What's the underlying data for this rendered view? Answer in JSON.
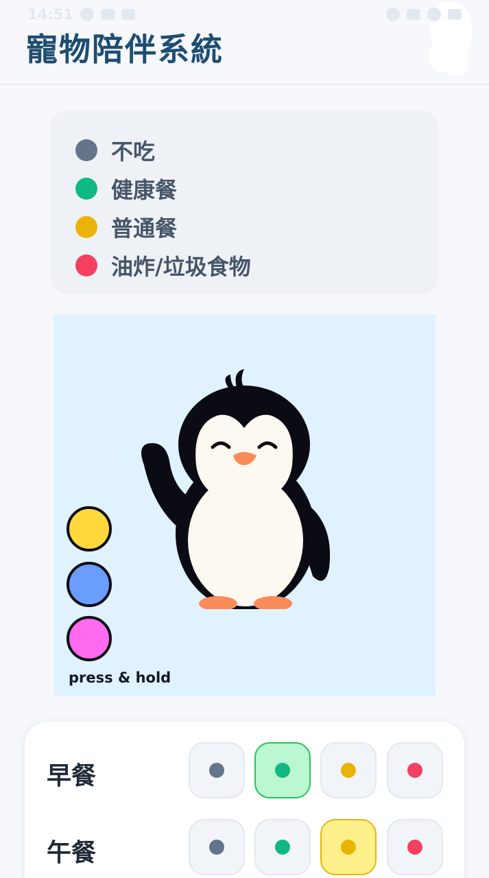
{
  "status_bar": {
    "time": "14:51"
  },
  "header": {
    "title": "寵物陪伴系統"
  },
  "colors": {
    "none": "#64748b",
    "healthy": "#10b981",
    "normal": "#eab308",
    "junk": "#f43f5e",
    "title": "#1e4d72",
    "pet_bg": "#e0f2fe"
  },
  "legend": [
    {
      "label": "不吃",
      "color": "#64748b"
    },
    {
      "label": "健康餐",
      "color": "#10b981"
    },
    {
      "label": "普通餐",
      "color": "#eab308"
    },
    {
      "label": "油炸/垃圾食物",
      "color": "#f43f5e"
    }
  ],
  "pet_area": {
    "color_options": [
      "#ffd93b",
      "#6b9cff",
      "#ff6aef"
    ],
    "hint": "press & hold"
  },
  "meals": [
    {
      "label": "早餐",
      "selected": "healthy"
    },
    {
      "label": "午餐",
      "selected": "normal"
    }
  ]
}
